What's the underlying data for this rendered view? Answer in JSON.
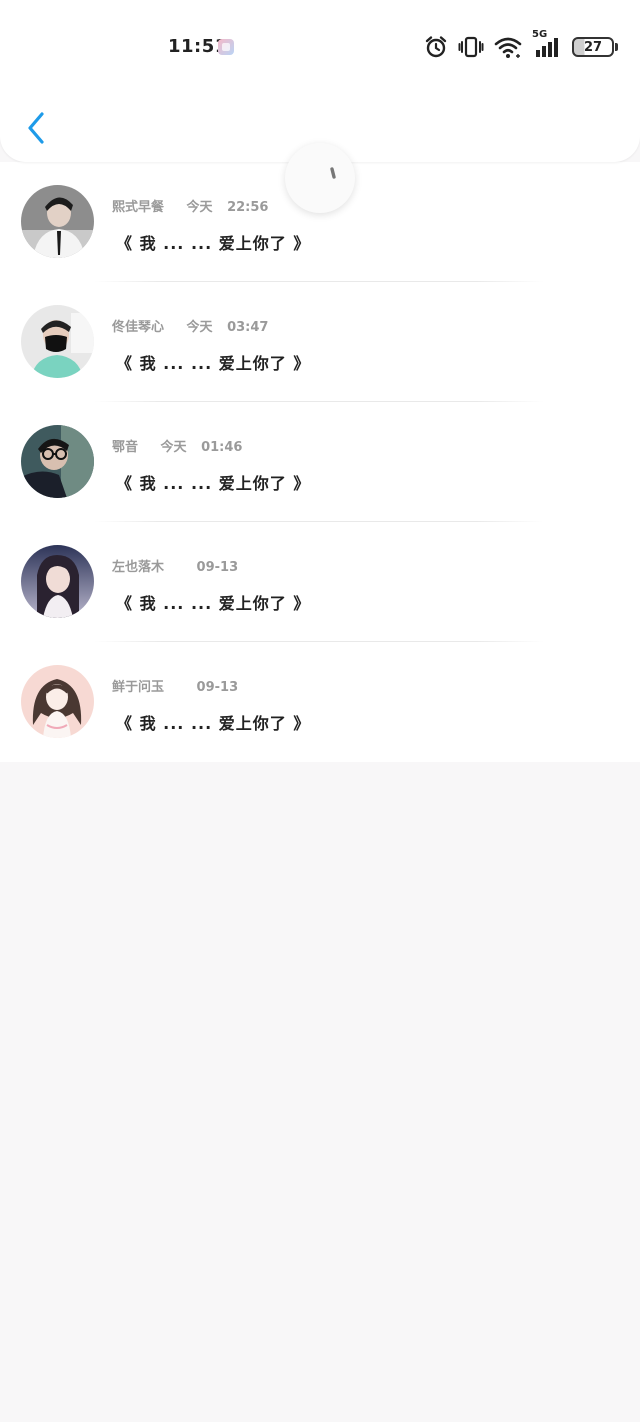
{
  "status_bar": {
    "time": "11:51",
    "network": "5G",
    "battery": "27"
  },
  "nav": {
    "back_label": "返回"
  },
  "colors": {
    "accent": "#1e9be9",
    "text_primary": "#222222",
    "text_secondary": "#9a9a9a",
    "background": "#f8f7f8"
  },
  "messages": [
    {
      "name": "熙式早餐",
      "date": "今天",
      "time": "22:56",
      "text": "《 我 ... ... 爱上你了 》"
    },
    {
      "name": "佟佳琴心",
      "date": "今天",
      "time": "03:47",
      "text": "《 我 ... ... 爱上你了 》"
    },
    {
      "name": "鄂音",
      "date": "今天",
      "time": "01:46",
      "text": "《 我 ... ... 爱上你了 》"
    },
    {
      "name": "左也落木",
      "date": "",
      "time": "09-13",
      "text": "《 我 ... ... 爱上你了 》"
    },
    {
      "name": "鲜于问玉",
      "date": "",
      "time": "09-13",
      "text": "《 我 ... ... 爱上你了 》"
    }
  ]
}
